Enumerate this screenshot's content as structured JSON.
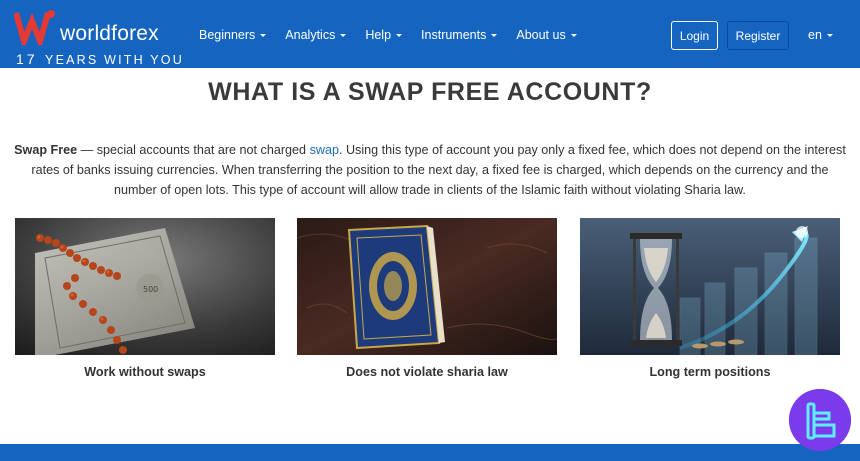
{
  "brand": {
    "name": "worldforex",
    "years_number": "17",
    "years_text": "YEARS WITH YOU",
    "color_primary": "#1565c0",
    "color_accent_red": "#e53935"
  },
  "nav": {
    "items": [
      {
        "label": "Beginners"
      },
      {
        "label": "Analytics"
      },
      {
        "label": "Help"
      },
      {
        "label": "Instruments"
      },
      {
        "label": "About us"
      }
    ],
    "login_label": "Login",
    "register_label": "Register",
    "language": "en"
  },
  "main": {
    "title": "WHAT IS A SWAP FREE ACCOUNT?",
    "desc_bold": "Swap Free",
    "desc_part1": " — special accounts that are not charged ",
    "desc_link": "swap",
    "desc_part2": ". Using this type of account you pay only a fixed fee, which does not depend on the interest rates of banks issuing currencies. When transferring the position to the next day, a fixed fee is charged, which depends on the currency and the number of open lots. This type of account will allow trade in clients of the Islamic faith without violating Sharia law.",
    "cards": [
      {
        "caption": "Work without swaps",
        "image": "prayer-beads-banknote-image"
      },
      {
        "caption": "Does not violate sharia law",
        "image": "quran-book-image"
      },
      {
        "caption": "Long term positions",
        "image": "hourglass-growth-chart-image"
      }
    ]
  },
  "widget": {
    "icon": "tradingfinder-logo-icon",
    "color": "#7c3aed"
  }
}
